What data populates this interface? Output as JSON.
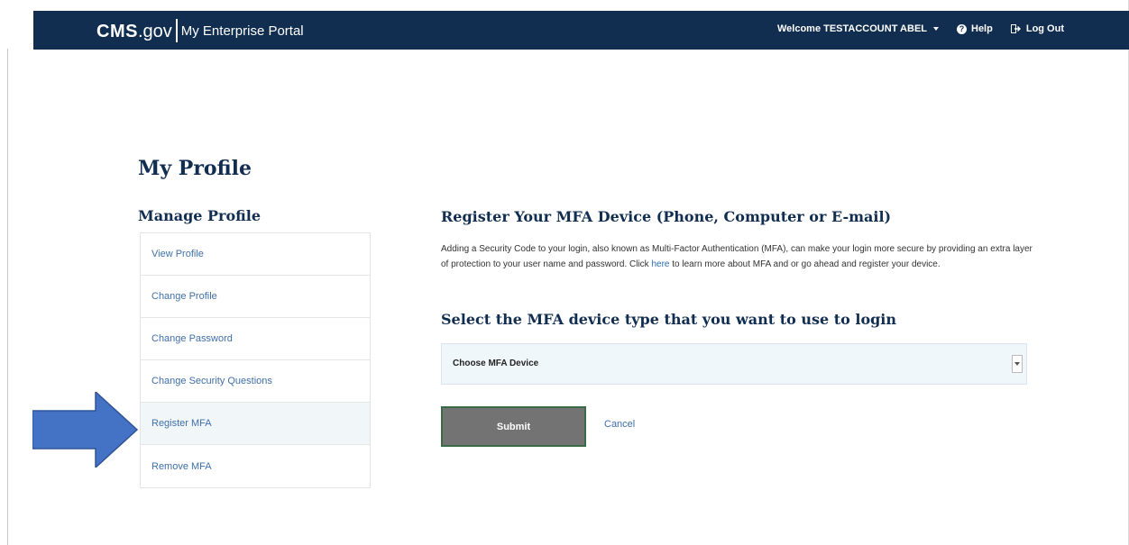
{
  "header": {
    "logo_main": "CMS",
    "logo_sub": ".gov",
    "logo_portal": "My Enterprise Portal",
    "welcome": "Welcome TESTACCOUNT ABEL",
    "help": "Help",
    "logout": "Log Out"
  },
  "page": {
    "title": "My Profile"
  },
  "sidebar": {
    "title": "Manage Profile",
    "items": [
      {
        "label": "View Profile"
      },
      {
        "label": "Change Profile"
      },
      {
        "label": "Change Password"
      },
      {
        "label": "Change Security Questions"
      },
      {
        "label": "Register MFA",
        "active": true
      },
      {
        "label": "Remove MFA"
      }
    ]
  },
  "main": {
    "title": "Register Your MFA Device (Phone, Computer or E-mail)",
    "desc_before": "Adding a Security Code to your login, also known as Multi-Factor Authentication (MFA), can make your login more secure by providing an extra layer of protection to your user name and password. Click ",
    "desc_link": "here",
    "desc_after": " to learn more about MFA and or go ahead and register your device.",
    "select_title": "Select the MFA device type that you want to use to login",
    "select_value": "Choose MFA Device",
    "submit": "Submit",
    "cancel": "Cancel"
  },
  "colors": {
    "header_bg": "#112e51",
    "link": "#3f6fa8",
    "arrow": "#4472c4"
  }
}
